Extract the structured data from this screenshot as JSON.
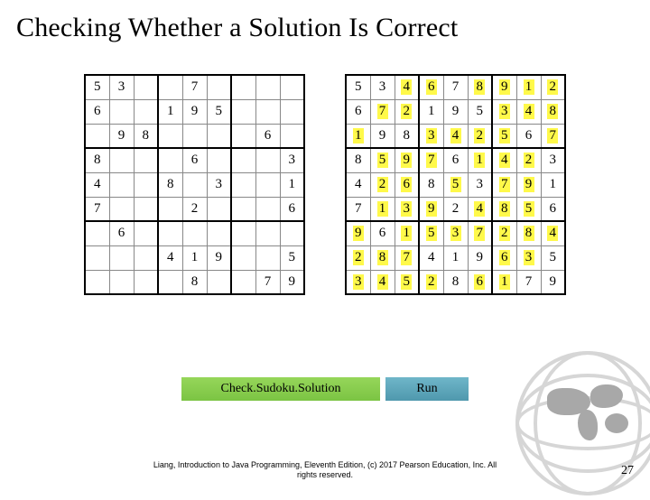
{
  "title": "Checking Whether a Solution Is Correct",
  "sudoku_puzzle": [
    [
      {
        "v": "5"
      },
      {
        "v": "3"
      },
      {
        "v": ""
      },
      {
        "v": ""
      },
      {
        "v": "7"
      },
      {
        "v": ""
      },
      {
        "v": ""
      },
      {
        "v": ""
      },
      {
        "v": ""
      }
    ],
    [
      {
        "v": "6"
      },
      {
        "v": ""
      },
      {
        "v": ""
      },
      {
        "v": "1"
      },
      {
        "v": "9"
      },
      {
        "v": "5"
      },
      {
        "v": ""
      },
      {
        "v": ""
      },
      {
        "v": ""
      }
    ],
    [
      {
        "v": ""
      },
      {
        "v": "9"
      },
      {
        "v": "8"
      },
      {
        "v": ""
      },
      {
        "v": ""
      },
      {
        "v": ""
      },
      {
        "v": ""
      },
      {
        "v": "6"
      },
      {
        "v": ""
      }
    ],
    [
      {
        "v": "8"
      },
      {
        "v": ""
      },
      {
        "v": ""
      },
      {
        "v": ""
      },
      {
        "v": "6"
      },
      {
        "v": ""
      },
      {
        "v": ""
      },
      {
        "v": ""
      },
      {
        "v": "3"
      }
    ],
    [
      {
        "v": "4"
      },
      {
        "v": ""
      },
      {
        "v": ""
      },
      {
        "v": "8"
      },
      {
        "v": ""
      },
      {
        "v": "3"
      },
      {
        "v": ""
      },
      {
        "v": ""
      },
      {
        "v": "1"
      }
    ],
    [
      {
        "v": "7"
      },
      {
        "v": ""
      },
      {
        "v": ""
      },
      {
        "v": ""
      },
      {
        "v": "2"
      },
      {
        "v": ""
      },
      {
        "v": ""
      },
      {
        "v": ""
      },
      {
        "v": "6"
      }
    ],
    [
      {
        "v": ""
      },
      {
        "v": "6"
      },
      {
        "v": ""
      },
      {
        "v": ""
      },
      {
        "v": ""
      },
      {
        "v": ""
      },
      {
        "v": ""
      },
      {
        "v": ""
      },
      {
        "v": ""
      }
    ],
    [
      {
        "v": ""
      },
      {
        "v": ""
      },
      {
        "v": ""
      },
      {
        "v": "4"
      },
      {
        "v": "1"
      },
      {
        "v": "9"
      },
      {
        "v": ""
      },
      {
        "v": ""
      },
      {
        "v": "5"
      }
    ],
    [
      {
        "v": ""
      },
      {
        "v": ""
      },
      {
        "v": ""
      },
      {
        "v": ""
      },
      {
        "v": "8"
      },
      {
        "v": ""
      },
      {
        "v": ""
      },
      {
        "v": "7"
      },
      {
        "v": "9"
      }
    ]
  ],
  "sudoku_solution": [
    [
      {
        "v": "5"
      },
      {
        "v": "3"
      },
      {
        "v": "4",
        "hl": true
      },
      {
        "v": "6",
        "hl": true
      },
      {
        "v": "7"
      },
      {
        "v": "8",
        "hl": true
      },
      {
        "v": "9",
        "hl": true
      },
      {
        "v": "1",
        "hl": true
      },
      {
        "v": "2",
        "hl": true
      }
    ],
    [
      {
        "v": "6"
      },
      {
        "v": "7",
        "hl": true
      },
      {
        "v": "2",
        "hl": true
      },
      {
        "v": "1"
      },
      {
        "v": "9"
      },
      {
        "v": "5"
      },
      {
        "v": "3",
        "hl": true
      },
      {
        "v": "4",
        "hl": true
      },
      {
        "v": "8",
        "hl": true
      }
    ],
    [
      {
        "v": "1",
        "hl": true
      },
      {
        "v": "9"
      },
      {
        "v": "8"
      },
      {
        "v": "3",
        "hl": true
      },
      {
        "v": "4",
        "hl": true
      },
      {
        "v": "2",
        "hl": true
      },
      {
        "v": "5",
        "hl": true
      },
      {
        "v": "6"
      },
      {
        "v": "7",
        "hl": true
      }
    ],
    [
      {
        "v": "8"
      },
      {
        "v": "5",
        "hl": true
      },
      {
        "v": "9",
        "hl": true
      },
      {
        "v": "7",
        "hl": true
      },
      {
        "v": "6"
      },
      {
        "v": "1",
        "hl": true
      },
      {
        "v": "4",
        "hl": true
      },
      {
        "v": "2",
        "hl": true
      },
      {
        "v": "3"
      }
    ],
    [
      {
        "v": "4"
      },
      {
        "v": "2",
        "hl": true
      },
      {
        "v": "6",
        "hl": true
      },
      {
        "v": "8"
      },
      {
        "v": "5",
        "hl": true
      },
      {
        "v": "3"
      },
      {
        "v": "7",
        "hl": true
      },
      {
        "v": "9",
        "hl": true
      },
      {
        "v": "1"
      }
    ],
    [
      {
        "v": "7"
      },
      {
        "v": "1",
        "hl": true
      },
      {
        "v": "3",
        "hl": true
      },
      {
        "v": "9",
        "hl": true
      },
      {
        "v": "2"
      },
      {
        "v": "4",
        "hl": true
      },
      {
        "v": "8",
        "hl": true
      },
      {
        "v": "5",
        "hl": true
      },
      {
        "v": "6"
      }
    ],
    [
      {
        "v": "9",
        "hl": true
      },
      {
        "v": "6"
      },
      {
        "v": "1",
        "hl": true
      },
      {
        "v": "5",
        "hl": true
      },
      {
        "v": "3",
        "hl": true
      },
      {
        "v": "7",
        "hl": true
      },
      {
        "v": "2",
        "hl": true
      },
      {
        "v": "8",
        "hl": true
      },
      {
        "v": "4",
        "hl": true
      }
    ],
    [
      {
        "v": "2",
        "hl": true
      },
      {
        "v": "8",
        "hl": true
      },
      {
        "v": "7",
        "hl": true
      },
      {
        "v": "4"
      },
      {
        "v": "1"
      },
      {
        "v": "9"
      },
      {
        "v": "6",
        "hl": true
      },
      {
        "v": "3",
        "hl": true
      },
      {
        "v": "5"
      }
    ],
    [
      {
        "v": "3",
        "hl": true
      },
      {
        "v": "4",
        "hl": true
      },
      {
        "v": "5",
        "hl": true
      },
      {
        "v": "2",
        "hl": true
      },
      {
        "v": "8"
      },
      {
        "v": "6",
        "hl": true
      },
      {
        "v": "1",
        "hl": true
      },
      {
        "v": "7"
      },
      {
        "v": "9"
      }
    ]
  ],
  "buttons": {
    "check_label": "Check.Sudoku.Solution",
    "run_label": "Run"
  },
  "footer": {
    "line1": "Liang, Introduction to Java Programming, Eleventh Edition, (c) 2017 Pearson Education, Inc. All",
    "line2": "rights reserved."
  },
  "page_number": "27"
}
